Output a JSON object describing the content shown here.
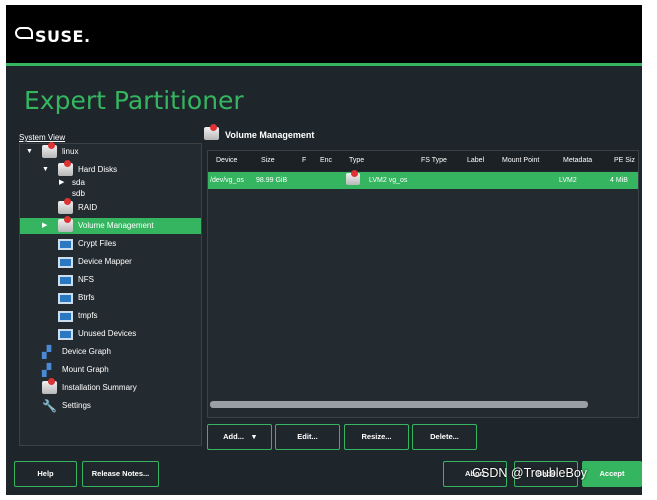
{
  "header": {
    "logo_text": "SUSE."
  },
  "page": {
    "title": "Expert Partitioner"
  },
  "system_view": {
    "label": "System View",
    "items": [
      {
        "label": "linux",
        "icon": "disk-icon"
      },
      {
        "label": "Hard Disks",
        "icon": "disk-icon"
      },
      {
        "label": "sda",
        "icon": ""
      },
      {
        "label": "sdb",
        "icon": ""
      },
      {
        "label": "RAID",
        "icon": "disk-icon"
      },
      {
        "label": "Volume Management",
        "icon": "disk-icon",
        "selected": true
      },
      {
        "label": "Crypt Files",
        "icon": "monitor-icon"
      },
      {
        "label": "Device Mapper",
        "icon": "monitor-icon"
      },
      {
        "label": "NFS",
        "icon": "monitor-icon"
      },
      {
        "label": "Btrfs",
        "icon": "monitor-icon"
      },
      {
        "label": "tmpfs",
        "icon": "monitor-icon"
      },
      {
        "label": "Unused Devices",
        "icon": "monitor-icon"
      },
      {
        "label": "Device Graph",
        "icon": "graph-icon"
      },
      {
        "label": "Mount Graph",
        "icon": "graph-icon"
      },
      {
        "label": "Installation Summary",
        "icon": "disk-icon"
      },
      {
        "label": "Settings",
        "icon": "wrench-icon"
      }
    ]
  },
  "volume_management": {
    "title": "Volume Management",
    "columns": [
      "Device",
      "Size",
      "F",
      "Enc",
      "Type",
      "FS Type",
      "Label",
      "Mount Point",
      "Metadata",
      "PE Siz"
    ],
    "rows": [
      {
        "device": "/dev/vg_os",
        "size": "98.99 GiB",
        "f": "",
        "enc": "",
        "type": "LVM2 vg_os",
        "fs_type": "",
        "label": "",
        "mount_point": "",
        "metadata": "LVM2",
        "pe_size": "4 MiB"
      }
    ],
    "scroll_fraction": 0.88
  },
  "actions": {
    "add": "Add...",
    "edit": "Edit...",
    "resize": "Resize...",
    "delete": "Delete..."
  },
  "footer": {
    "help": "Help",
    "release_notes": "Release Notes...",
    "abort": "Abort",
    "back": "Back",
    "accept": "Accept"
  },
  "watermark": "CSDN @TroubleBoy"
}
